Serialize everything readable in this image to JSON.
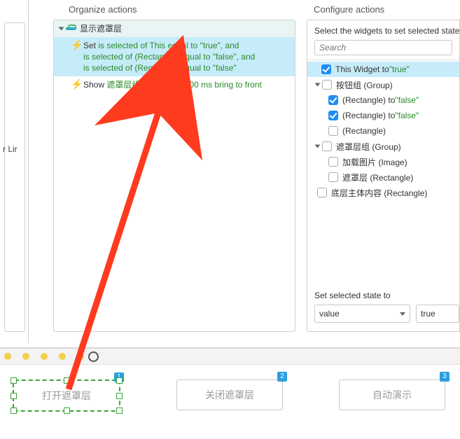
{
  "west_label": "r Lir",
  "organize": {
    "title": "Organize actions",
    "case_label": "显示遮罩层",
    "set_line1_pre": "Set ",
    "set_line1": "is selected of This equal to \"true\", and",
    "set_line2": "is selected of (Rectangle) equal to \"false\", and",
    "set_line3": "is selected of (Rectangle) equal to \"false\"",
    "show_pre": "Show ",
    "show_target": "遮罩层组",
    "show_rest": " slide down 500 ms bring to front"
  },
  "configure": {
    "title": "Configure actions",
    "subtitle": "Select the widgets to set selected state",
    "search_placeholder": "Search",
    "items": [
      {
        "indent": 20,
        "arrow": false,
        "checked": true,
        "label": "This Widget to ",
        "quote": "\"true\"",
        "hl": true
      },
      {
        "indent": 8,
        "arrow": true,
        "checked": false,
        "label": "按钮组 (Group)",
        "quote": ""
      },
      {
        "indent": 30,
        "arrow": false,
        "checked": true,
        "label": "(Rectangle) to ",
        "quote": "\"false\""
      },
      {
        "indent": 30,
        "arrow": false,
        "checked": true,
        "label": "(Rectangle) to ",
        "quote": "\"false\""
      },
      {
        "indent": 30,
        "arrow": false,
        "checked": false,
        "label": "(Rectangle)",
        "quote": ""
      },
      {
        "indent": 8,
        "arrow": true,
        "checked": false,
        "label": "遮罩层组 (Group)",
        "quote": ""
      },
      {
        "indent": 30,
        "arrow": false,
        "checked": false,
        "label": "加载图片 (Image)",
        "quote": ""
      },
      {
        "indent": 30,
        "arrow": false,
        "checked": false,
        "label": "遮罩层 (Rectangle)",
        "quote": ""
      },
      {
        "indent": 14,
        "arrow": false,
        "checked": false,
        "label": "底层主体内容 (Rectangle)",
        "quote": ""
      }
    ],
    "set_state_label": "Set selected state to",
    "dd_value": "value",
    "dd_true": "true"
  },
  "canvas": {
    "buttons": [
      {
        "label": "打开遮罩层",
        "tag": "1",
        "selected": true
      },
      {
        "label": "关闭遮罩层",
        "tag": "2",
        "selected": false
      },
      {
        "label": "自动演示",
        "tag": "3",
        "selected": false
      }
    ]
  }
}
